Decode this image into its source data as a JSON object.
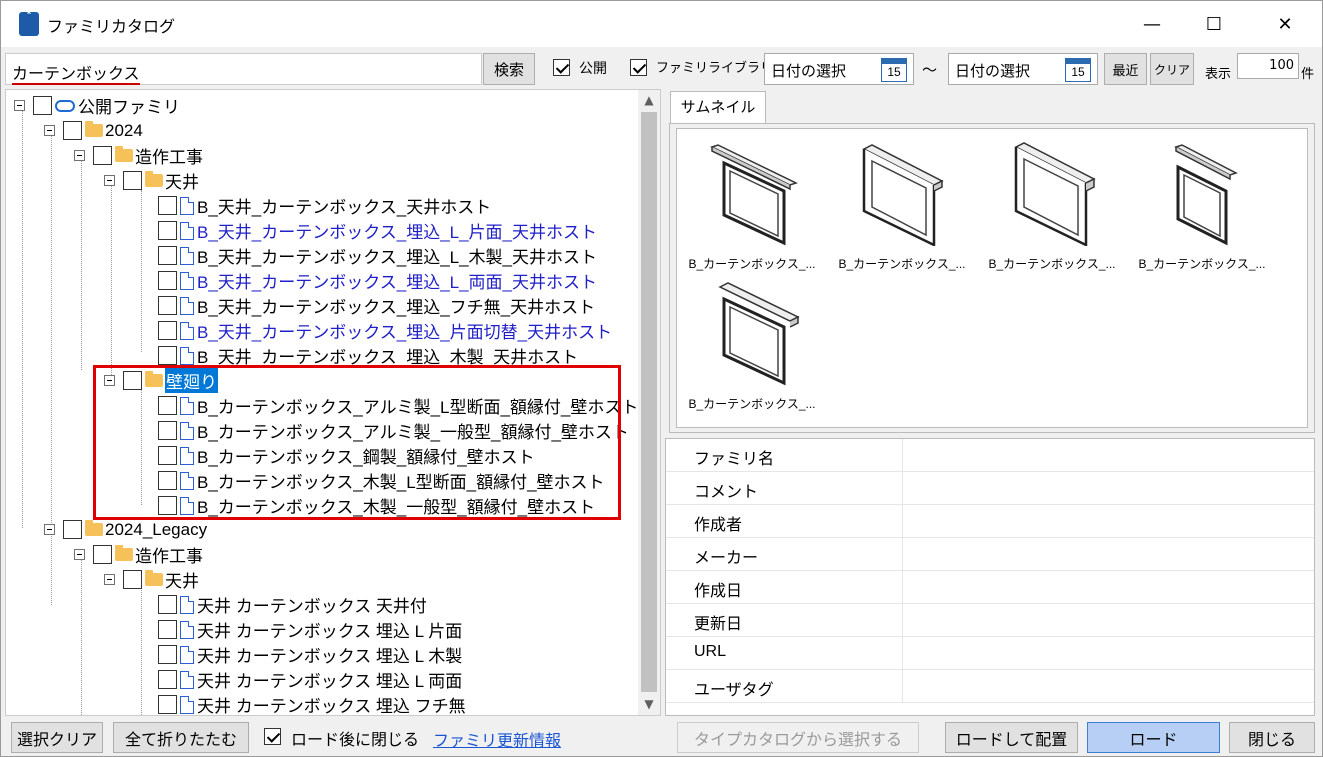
{
  "window": {
    "title": "ファミリカタログ",
    "min": "—",
    "max": "☐",
    "close": "✕",
    "icon_letter": "R"
  },
  "toolbar": {
    "search_value": "カーテンボックス",
    "search_button": "検索",
    "public_label": "公開",
    "public_checked": true,
    "library_label": "ファミリライブラリ",
    "library_checked": true,
    "date_from": "日付の選択",
    "date_to": "日付の選択",
    "calendar_day": "15",
    "tilde": "～",
    "recent_button": "最近",
    "clear_button": "クリア",
    "show_label": "表示",
    "count_value": "100",
    "count_unit": "件"
  },
  "tree": {
    "root": "公開ファミリ",
    "y2024": "2024",
    "zousaku": "造作工事",
    "tenjo": "天井",
    "tenjo_items": [
      {
        "label": "B_天井_カーテンボックス_天井ホスト",
        "blue": false
      },
      {
        "label": "B_天井_カーテンボックス_埋込_L_片面_天井ホスト",
        "blue": true
      },
      {
        "label": "B_天井_カーテンボックス_埋込_L_木製_天井ホスト",
        "blue": false
      },
      {
        "label": "B_天井_カーテンボックス_埋込_L_両面_天井ホスト",
        "blue": true
      },
      {
        "label": "B_天井_カーテンボックス_埋込_フチ無_天井ホスト",
        "blue": false
      },
      {
        "label": "B_天井_カーテンボックス_埋込_片面切替_天井ホスト",
        "blue": true
      },
      {
        "label": "B_天井_カーテンボックス_埋込_木製_天井ホスト",
        "blue": false
      }
    ],
    "kabe": "壁廻り",
    "kabe_items": [
      "B_カーテンボックス_アルミ製_L型断面_額縁付_壁ホスト",
      "B_カーテンボックス_アルミ製_一般型_額縁付_壁ホスト",
      "B_カーテンボックス_鋼製_額縁付_壁ホスト",
      "B_カーテンボックス_木製_L型断面_額縁付_壁ホスト",
      "B_カーテンボックス_木製_一般型_額縁付_壁ホスト"
    ],
    "legacy": "2024_Legacy",
    "legacy_zousaku": "造作工事",
    "legacy_tenjo": "天井",
    "legacy_items": [
      "天井 カーテンボックス 天井付",
      "天井 カーテンボックス 埋込 L 片面",
      "天井 カーテンボックス 埋込 L 木製",
      "天井 カーテンボックス 埋込 L 両面",
      "天井 カーテンボックス 埋込 フチ無"
    ]
  },
  "thumbnails": {
    "tab": "サムネイル",
    "items": [
      "B_カーテンボックス_...",
      "B_カーテンボックス_...",
      "B_カーテンボックス_...",
      "B_カーテンボックス_...",
      "B_カーテンボックス_..."
    ]
  },
  "properties": [
    "ファミリ名",
    "コメント",
    "作成者",
    "メーカー",
    "作成日",
    "更新日",
    "URL",
    "ユーザタグ"
  ],
  "bottom": {
    "clear_selection": "選択クリア",
    "collapse_all": "全て折りたたむ",
    "close_after_load": "ロード後に閉じる",
    "close_after_load_checked": true,
    "update_info": "ファミリ更新情報",
    "select_from_type_catalog": "タイプカタログから選択する",
    "load_and_place": "ロードして配置",
    "load": "ロード",
    "close": "閉じる"
  },
  "colors": {
    "accent_blue": "#2020c8",
    "selection": "#0078d7",
    "highlight_box": "#e00000",
    "load_button": "#b8cff5"
  }
}
